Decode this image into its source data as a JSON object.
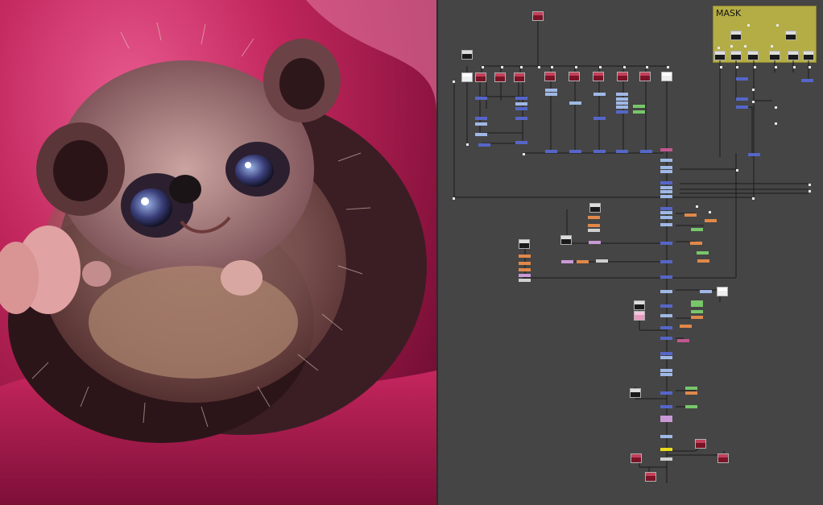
{
  "viewer": {
    "content": "hedgehog-render"
  },
  "node_graph": {
    "backdrop_label": "MASK",
    "colors": {
      "background": "#454545",
      "merge": "#5566c8",
      "color_correct": "#e0884a",
      "transform": "#78c76b",
      "backdrop": "#b4ad45"
    }
  }
}
